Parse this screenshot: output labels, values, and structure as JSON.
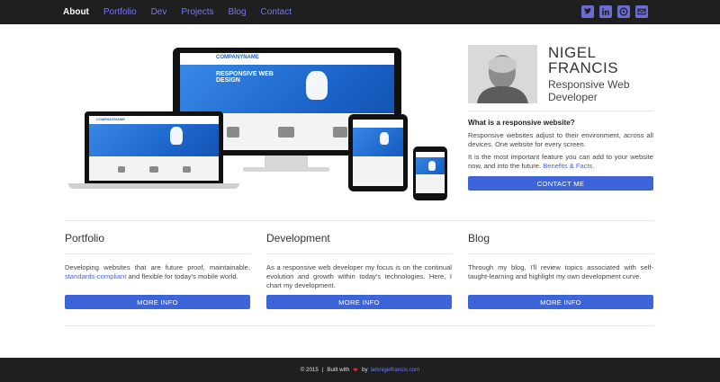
{
  "nav": {
    "links": [
      {
        "label": "About",
        "active": true
      },
      {
        "label": "Portfolio",
        "active": false
      },
      {
        "label": "Dev",
        "active": false
      },
      {
        "label": "Projects",
        "active": false
      },
      {
        "label": "Blog",
        "active": false
      },
      {
        "label": "Contact",
        "active": false
      }
    ],
    "social_icons": [
      "twitter-icon",
      "linkedin-icon",
      "github-icon",
      "email-icon"
    ]
  },
  "hero": {
    "mockup": {
      "brand": "COMPANYNAME",
      "headline": "RESPONSIVE WEB DESIGN"
    },
    "profile": {
      "name_line1": "NIGEL",
      "name_line2": "FRANCIS",
      "role": "Responsive Web Developer",
      "question": "What is a responsive website?",
      "para1": "Responsive websites adjust to their environment, across all devices. One website for every screen.",
      "para2_text": "It is the most important feature you can add to your website now, and into the future.",
      "para2_link": "Benefits & Facts.",
      "contact_button": "CONTACT ME"
    }
  },
  "columns": [
    {
      "title": "Portfolio",
      "text_before": "Developing websites that are future proof, maintainable,",
      "link": "standards-compliant",
      "text_after": "and flexible for today's mobile world.",
      "button": "MORE INFO"
    },
    {
      "title": "Development",
      "text_before": "As a responsive web developer my focus is on the continual evolution and growth within today's technologies. Here, I chart my development.",
      "link": "",
      "text_after": "",
      "button": "MORE INFO"
    },
    {
      "title": "Blog",
      "text_before": "Through my blog, I'll review topics associated with self-taught-learning and highlight my own development curve.",
      "link": "",
      "text_after": "",
      "button": "MORE INFO"
    }
  ],
  "footer": {
    "copyright": "© 2015",
    "built_with": "Built with",
    "by": "by",
    "site": "iamnigelfrancis.com"
  },
  "colors": {
    "accent": "#3d64d8",
    "nav_bg": "#1f1f1f",
    "link": "#7a73ff"
  }
}
